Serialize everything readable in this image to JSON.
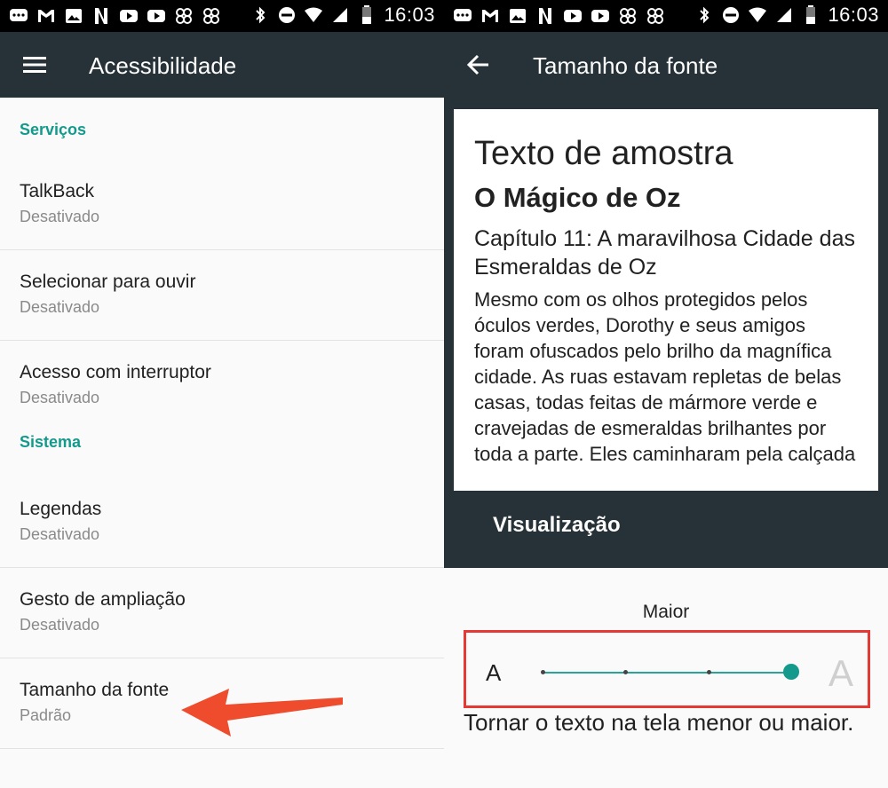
{
  "status_bar": {
    "time": "16:03"
  },
  "left": {
    "title": "Acessibilidade",
    "sections": [
      {
        "header": "Serviços",
        "items": [
          {
            "title": "TalkBack",
            "subtitle": "Desativado"
          },
          {
            "title": "Selecionar para ouvir",
            "subtitle": "Desativado"
          },
          {
            "title": "Acesso com interruptor",
            "subtitle": "Desativado"
          }
        ]
      },
      {
        "header": "Sistema",
        "items": [
          {
            "title": "Legendas",
            "subtitle": "Desativado"
          },
          {
            "title": "Gesto de ampliação",
            "subtitle": "Desativado"
          },
          {
            "title": "Tamanho da fonte",
            "subtitle": "Padrão"
          }
        ]
      }
    ]
  },
  "right": {
    "title": "Tamanho da fonte",
    "preview": {
      "heading": "Texto de amostra",
      "book": "O Mágico de Oz",
      "chapter": "Capítulo 11: A maravilhosa Cidade das Esmeraldas de Oz",
      "body": "Mesmo com os olhos protegidos pelos óculos verdes, Dorothy e seus amigos foram ofuscados pelo brilho da magnífica cidade. As ruas estavam repletas de belas casas, todas feitas de mármore verde e cravejadas de esmeraldas brilhantes por toda a parte. Eles caminharam pela calçada",
      "label": "Visualização"
    },
    "size_label": "Maior",
    "small_a": "A",
    "large_a": "A",
    "slider": {
      "steps": 4,
      "selected_index": 3
    },
    "hint": "Tornar o texto na tela menor ou maior."
  },
  "colors": {
    "accent": "#139a8c",
    "appbar": "#263238",
    "highlight": "#e53935"
  }
}
